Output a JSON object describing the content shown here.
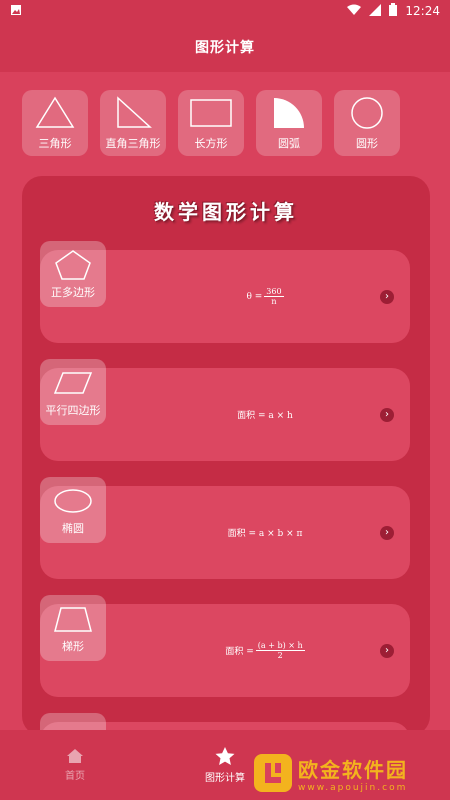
{
  "status_bar": {
    "time": "12:24",
    "icons": [
      "image-icon",
      "wifi-icon",
      "signal-icon",
      "battery-icon"
    ]
  },
  "app_bar": {
    "title": "图形计算"
  },
  "shape_tabs": [
    {
      "label": "三角形",
      "icon": "triangle-icon"
    },
    {
      "label": "直角三角形",
      "icon": "right-triangle-icon"
    },
    {
      "label": "长方形",
      "icon": "rectangle-icon"
    },
    {
      "label": "圆弧",
      "icon": "arc-icon"
    },
    {
      "label": "圆形",
      "icon": "circle-icon"
    }
  ],
  "panel": {
    "title": "数学图形计算",
    "cards": [
      {
        "label": "正多边形",
        "icon": "pentagon-icon",
        "formula_prefix": "θ =",
        "formula_num": "360",
        "formula_den": "n"
      },
      {
        "label": "平行四边形",
        "icon": "parallelogram-icon",
        "formula": "面积 = a × h"
      },
      {
        "label": "椭圆",
        "icon": "ellipse-icon",
        "formula": "面积 = a × b × π"
      },
      {
        "label": "梯形",
        "icon": "trapezoid-icon",
        "formula_prefix": "面积 =",
        "formula_num": "(a + b) × h",
        "formula_den": "2"
      }
    ]
  },
  "bottom_nav": [
    {
      "label": "首页",
      "icon": "home-icon",
      "active": false
    },
    {
      "label": "图形计算",
      "icon": "star-icon",
      "active": true
    }
  ],
  "watermark": {
    "title": "欧金软件园",
    "url": "www.apoujin.com"
  },
  "colors": {
    "background": "#d9415c",
    "panel": "#c52c45",
    "card": "#dc4761",
    "accent": "#f3b31e"
  }
}
